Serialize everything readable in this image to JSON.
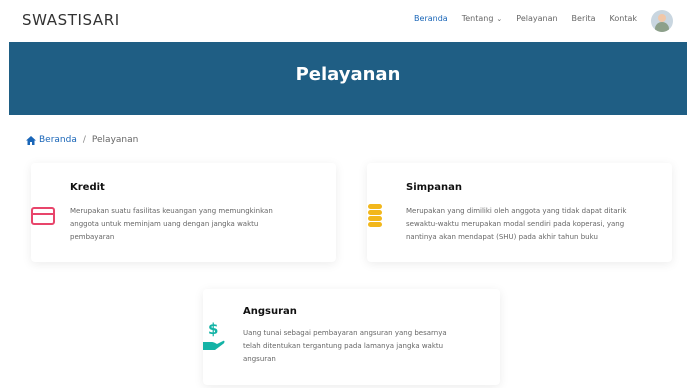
{
  "brand": "SWASTISARI",
  "nav": {
    "beranda": "Beranda",
    "tentang": "Tentang",
    "pelayanan": "Pelayanan",
    "berita": "Berita",
    "kontak": "Kontak"
  },
  "hero": {
    "title": "Pelayanan"
  },
  "breadcrumb": {
    "home": "Beranda",
    "separator": "/",
    "current": "Pelayanan"
  },
  "cards": [
    {
      "title": "Kredit",
      "icon": "credit-card-icon",
      "lines": [
        "Merupakan suatu fasilitas keuangan yang memungkinkan",
        "anggota untuk meminjam uang dengan jangka waktu",
        "pembayaran"
      ]
    },
    {
      "title": "Simpanan",
      "icon": "coins-icon",
      "lines": [
        "Merupakan yang dimiliki oleh anggota yang tidak dapat ditarik",
        "sewaktu-waktu merupakan modal sendiri pada koperasi, yang",
        "nantinya akan mendapat (SHU) pada akhir tahun buku"
      ]
    },
    {
      "title": "Angsuran",
      "icon": "hand-money-icon",
      "lines": [
        "Uang tunai sebagai pembayaran angsuran yang besarnya",
        "telah ditentukan tergantung pada lamanya jangka waktu",
        "angsuran"
      ]
    }
  ],
  "colors": {
    "hero": "#1f5e84",
    "link": "#1a66b8",
    "credit_icon": "#e8456b",
    "coins_icon": "#f2b71b",
    "money_icon": "#14b3a6"
  }
}
